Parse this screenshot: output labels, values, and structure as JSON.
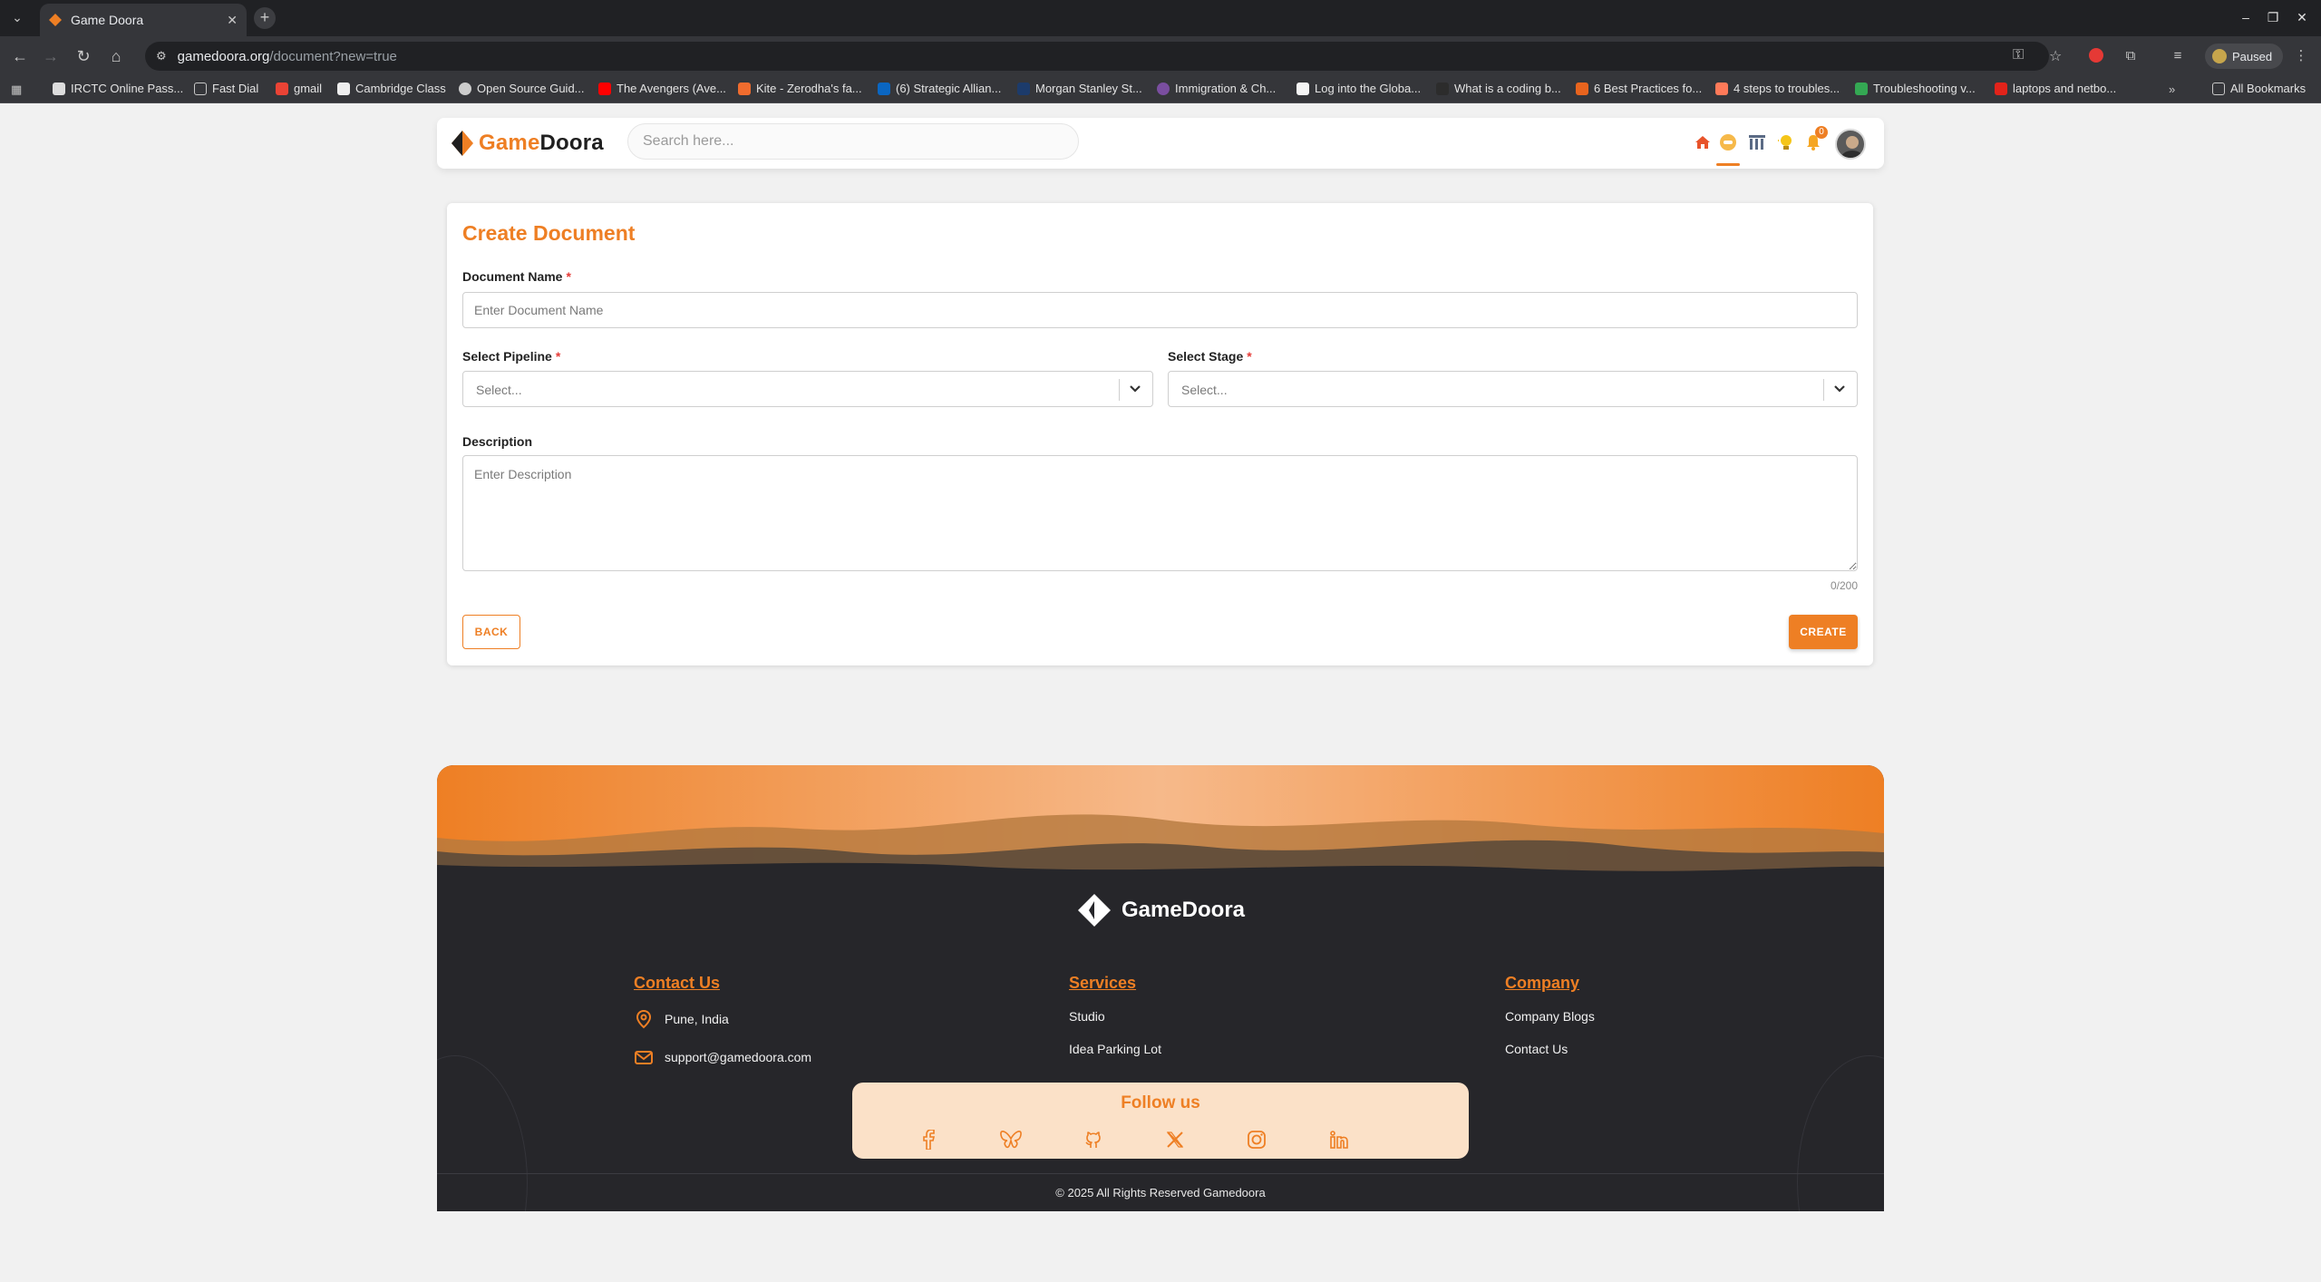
{
  "browser": {
    "tab_title": "Game Doora",
    "url_host": "gamedoora.org",
    "url_path": "/document?new=true",
    "profile_status": "Paused",
    "bookmarks": [
      "IRCTC Online Pass...",
      "Fast Dial",
      "gmail",
      "Cambridge Class",
      "Open Source Guid...",
      "The Avengers (Ave...",
      "Kite - Zerodha's fa...",
      "(6) Strategic Allian...",
      "Morgan Stanley St...",
      "Immigration & Ch...",
      "Log into the Globa...",
      "What is a coding b...",
      "6 Best Practices fo...",
      "4 steps to troubles...",
      "Troubleshooting v...",
      "laptops and netbo..."
    ],
    "all_bookmarks": "All Bookmarks"
  },
  "header": {
    "logo_prefix": "Game",
    "logo_suffix": "Doora",
    "search_placeholder": "Search here...",
    "notification_count": "0",
    "icons": [
      "home-icon",
      "games-icon",
      "library-icon",
      "idea-bulb-icon",
      "bell-icon"
    ]
  },
  "form": {
    "title": "Create Document",
    "document_name_label": "Document Name",
    "document_name_placeholder": "Enter Document Name",
    "pipeline_label": "Select Pipeline",
    "pipeline_placeholder": "Select...",
    "stage_label": "Select Stage",
    "stage_placeholder": "Select...",
    "description_label": "Description",
    "description_placeholder": "Enter Description",
    "char_count": "0/200",
    "required_mark": "*",
    "back_label": "BACK",
    "create_label": "CREATE"
  },
  "footer": {
    "logo_text": "GameDoora",
    "contact": {
      "heading": "Contact Us",
      "location": "Pune, India",
      "email": "support@gamedoora.com"
    },
    "services": {
      "heading": "Services",
      "items": [
        "Studio",
        "Idea Parking Lot"
      ]
    },
    "company": {
      "heading": "Company",
      "items": [
        "Company Blogs",
        "Contact Us"
      ]
    },
    "follow_title": "Follow us",
    "social": [
      "facebook-icon",
      "bluesky-icon",
      "github-icon",
      "x-icon",
      "instagram-icon",
      "linkedin-icon"
    ],
    "copyright": "© 2025 All Rights Reserved Gamedoora"
  },
  "colors": {
    "accent": "#ee7f24",
    "footer_bg": "#26262a",
    "follow_bg": "#fbe1c8"
  }
}
